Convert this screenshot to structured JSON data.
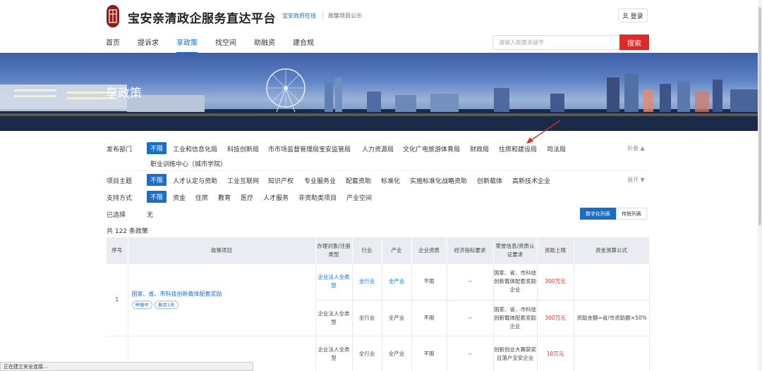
{
  "header": {
    "brand": "宝安亲清政企服务直达平台",
    "link1": "宝安政府在线",
    "link2": "政策项目公示",
    "login": "登录",
    "search_placeholder": "请输入政策关键字",
    "search_button": "搜索"
  },
  "nav": [
    "首页",
    "提诉求",
    "享政策",
    "找空间",
    "助融资",
    "建合规"
  ],
  "banner": {
    "title": "享政策"
  },
  "filters": {
    "dept_label": "发布部门",
    "dept_items": [
      "不限",
      "工业和信息化局",
      "科技创新局",
      "市市场监督管理局宝安监管局",
      "人力资源局",
      "文化广电旅游体育局",
      "财政局",
      "住房和建设局",
      "司法局",
      "职业训练中心（城市学院）"
    ],
    "fold_text": "折叠",
    "topic_label": "项目主题",
    "topic_items": [
      "不限",
      "人才认定与资助",
      "工业互联网",
      "知识产权",
      "专业服务业",
      "配套资助",
      "标准化",
      "实施标准化战略资助",
      "创新载体",
      "高新技术企业"
    ],
    "expand_text": "展开",
    "support_label": "支持方式",
    "support_items": [
      "不限",
      "资金",
      "住房",
      "教育",
      "医疗",
      "人才服务",
      "非资助类项目",
      "产业空间"
    ],
    "selected_label": "已选择",
    "selected_value": "无"
  },
  "view": {
    "digital": "数字化列表",
    "traditional": "传统列表"
  },
  "total": "共 122 条政策",
  "table": {
    "headers": [
      "序号",
      "政策项目",
      "办理对象/注册类型",
      "行业",
      "产业",
      "企业资质",
      "经济指标要求",
      "荣誉信息/资质认证要求",
      "资助上限",
      "资金测算公式"
    ],
    "row1": {
      "index": "1",
      "title": "国家、省、市科技创新载体配套奖励",
      "tag1": "申报中",
      "tag2": "剩余1天",
      "sub": [
        {
          "obj": "企业法人全类型",
          "industry": "全行业",
          "chain": "全产业",
          "qual": "不限",
          "econ": "--",
          "honor": "国家、省、市科技创新载体配套奖励企业",
          "limit": "300万元",
          "formula": ""
        },
        {
          "obj": "企业法人全类型",
          "industry": "全行业",
          "chain": "全产业",
          "qual": "不限",
          "econ": "--",
          "honor": "国家、省、市科技创新载体配套奖励企业",
          "limit": "300万元",
          "formula": "资助金额=省/市资助额×50%"
        }
      ]
    },
    "row2": {
      "sub": [
        {
          "obj": "企业法人全类型",
          "industry": "全行业",
          "chain": "全产业",
          "qual": "不限",
          "econ": "--",
          "honor": "创新创业大赛获奖且落户宝安企业",
          "limit": "10万元",
          "formula": ""
        }
      ]
    }
  },
  "statusbar": "正在建立安全连接..."
}
